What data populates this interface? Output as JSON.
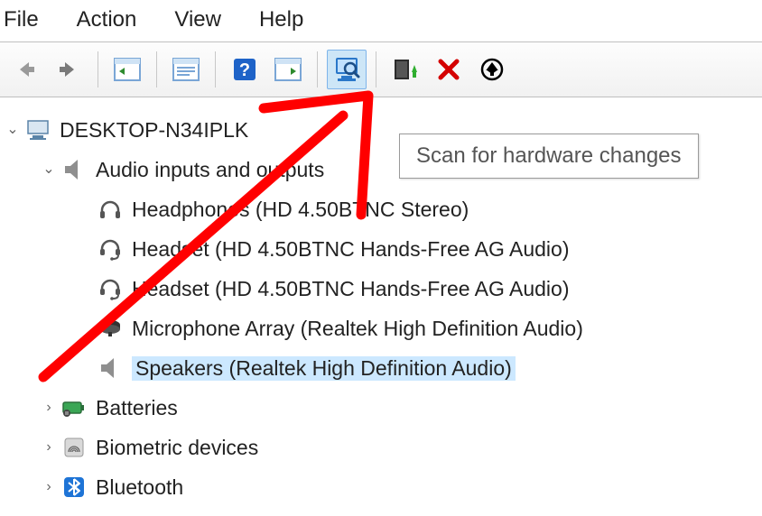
{
  "menu": {
    "file": "File",
    "action": "Action",
    "view": "View",
    "help": "Help"
  },
  "toolbar": {
    "back": "Back",
    "forward": "Forward",
    "show_hide_tree": "Show/Hide Console Tree",
    "properties": "Properties",
    "help": "Help",
    "show_hide_action": "Show/Hide Action Pane",
    "scan": "Scan for hardware changes",
    "update_driver": "Update Driver Software",
    "uninstall": "Uninstall device",
    "disable": "Disable device"
  },
  "tooltip": "Scan for hardware changes",
  "tree": {
    "root": {
      "label": "DESKTOP-N34IPLK",
      "expanded": true
    },
    "audio": {
      "label": "Audio inputs and outputs",
      "expanded": true,
      "children": [
        {
          "label": "Headphones (HD 4.50BTNC Stereo)",
          "icon": "headphones"
        },
        {
          "label": "Headset (HD 4.50BTNC Hands-Free AG Audio)",
          "icon": "headset"
        },
        {
          "label": "Headset (HD 4.50BTNC Hands-Free AG Audio)",
          "icon": "headset"
        },
        {
          "label": "Microphone Array (Realtek High Definition Audio)",
          "icon": "microphone"
        },
        {
          "label": "Speakers (Realtek High Definition Audio)",
          "icon": "speaker",
          "selected": true
        }
      ]
    },
    "batteries": {
      "label": "Batteries",
      "expanded": false
    },
    "biometric": {
      "label": "Biometric devices",
      "expanded": false
    },
    "bluetooth": {
      "label": "Bluetooth",
      "expanded": false
    }
  },
  "annotation": {
    "type": "arrow",
    "color": "#ff0000"
  }
}
